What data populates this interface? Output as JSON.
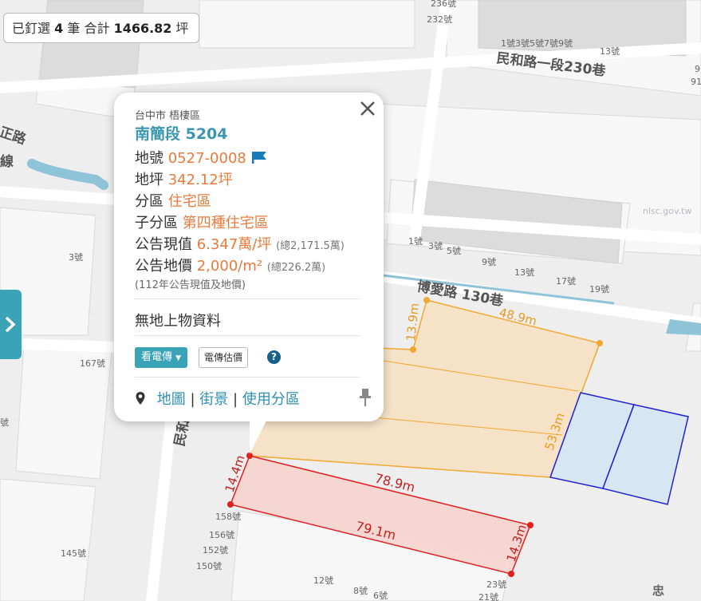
{
  "summary": {
    "prefix": "已釘選",
    "count": "4",
    "count_unit": "筆",
    "total_label": "合計",
    "total_value": "1466.82",
    "total_unit": "坪"
  },
  "map": {
    "roads": [
      "民和路一段230巷",
      "博愛路 130巷",
      "民和路一段",
      "正路",
      "線"
    ],
    "house_numbers": [
      "236號",
      "232號",
      "1號3號5號7號9號",
      "13號",
      "9",
      "91",
      "1號",
      "3號",
      "5號",
      "9號",
      "13號",
      "17號",
      "19號",
      "3號",
      "167號",
      "號",
      "158號",
      "156號",
      "152號",
      "150號",
      "145號",
      "12號",
      "8號",
      "6號",
      "23號",
      "21號",
      "忠"
    ],
    "watermark": "nlsc.gov.tw",
    "measurements": {
      "orange_top": "48.9m",
      "orange_left_step": "13.9m",
      "orange_right": "53.3m",
      "shared_edge": "78.9m",
      "red_bottom": "79.1m",
      "red_left": "14.4m",
      "red_right": "14.3m"
    },
    "colors": {
      "orange_fill": "#f6dfc0",
      "orange_stroke": "#f0a830",
      "red_fill": "#f6d3cd",
      "red_stroke": "#e02020",
      "blue_fill": "#d6e6f3",
      "blue_stroke": "#2020d0",
      "accent": "#3aa3b8"
    }
  },
  "popup": {
    "region": "台中市 梧棲區",
    "parcel": "南簡段 5204",
    "rows": [
      {
        "label": "地號",
        "value": "0527-0008",
        "suffix": ""
      },
      {
        "label": "地坪",
        "value": "342.12坪",
        "suffix": ""
      },
      {
        "label": "分區",
        "value": "住宅區",
        "suffix": ""
      },
      {
        "label": "子分區",
        "value": "第四種住宅區",
        "suffix": ""
      },
      {
        "label": "公告現值",
        "value": "6.347萬/坪",
        "suffix": "(總2,171.5萬)"
      },
      {
        "label": "公告地價",
        "value": "2,000/m²",
        "suffix": "(總226.2萬)"
      }
    ],
    "note": "(112年公告現值及地價)",
    "no_building": "無地上物資料",
    "btn_telegram": "看電傳",
    "btn_estimate": "電傳估價",
    "help": "?",
    "link_map": "地圖",
    "link_street": "街景",
    "link_zoning": "使用分區",
    "sep": "|"
  }
}
